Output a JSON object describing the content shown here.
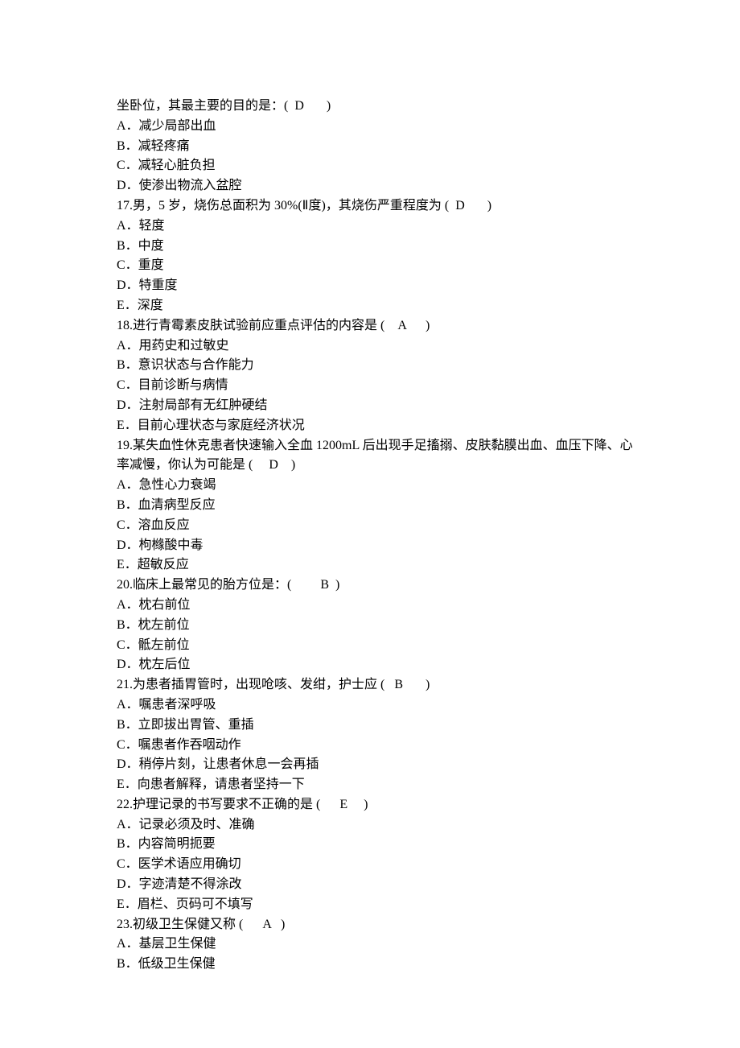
{
  "lines": [
    "坐卧位，其最主要的目的是：(  D       )",
    "A．减少局部出血",
    "B．减轻疼痛",
    "C．减轻心脏负担",
    "D．使渗出物流入盆腔",
    "17.男，5 岁，烧伤总面积为 30%(Ⅱ度)，其烧伤严重程度为 (  D       )",
    "A．轻度",
    "B．中度",
    "C．重度",
    "D．特重度",
    "E．深度",
    "18.进行青霉素皮肤试验前应重点评估的内容是 (    A      )",
    "A．用药史和过敏史",
    "B．意识状态与合作能力",
    "C．目前诊断与病情",
    "D．注射局部有无红肿硬结",
    "E．目前心理状态与家庭经济状况",
    "19.某失血性休克患者快速输入全血 1200mL 后出现手足搐搦、皮肤黏膜出血、血压下降、心率减慢，你认为可能是 (     D    )",
    "A．急性心力衰竭",
    "B．血清病型反应",
    "C．溶血反应",
    "D．枸橼酸中毒",
    "E．超敏反应",
    "20.临床上最常见的胎方位是：(         B  )",
    "A．枕右前位",
    "B．枕左前位",
    "C．骶左前位",
    "D．枕左后位",
    "21.为患者插胃管时，出现呛咳、发绀，护士应 (   B       )",
    "A．嘱患者深呼吸",
    "B．立即拔出胃管、重插",
    "C．嘱患者作吞咽动作",
    "D．稍停片刻，让患者休息一会再插",
    "E．向患者解释，请患者坚持一下",
    "22.护理记录的书写要求不正确的是 (      E     )",
    "A．记录必须及时、准确",
    "B．内容简明扼要",
    "C．医学术语应用确切",
    "D．字迹清楚不得涂改",
    "E．眉栏、页码可不填写",
    "23.初级卫生保健又称 (      A   )",
    "A．基层卫生保健",
    "B．低级卫生保健"
  ]
}
